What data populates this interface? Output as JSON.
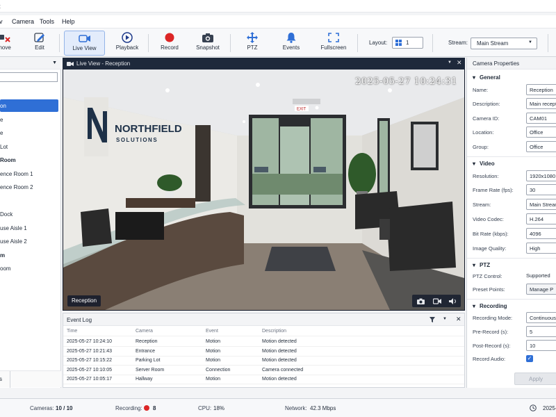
{
  "app": {
    "title_fragment": "t"
  },
  "menu": [
    "v",
    "Camera",
    "Tools",
    "Help"
  ],
  "toolbar": {
    "buttons": [
      {
        "label": "move",
        "icon": "remove-camera-icon"
      },
      {
        "label": "Edit",
        "icon": "edit-icon"
      },
      {
        "label": "Live View",
        "icon": "video-camera-icon"
      },
      {
        "label": "Playback",
        "icon": "play-icon"
      },
      {
        "label": "Record",
        "icon": "record-icon"
      },
      {
        "label": "Snapshot",
        "icon": "camera-icon"
      },
      {
        "label": "PTZ",
        "icon": "ptz-arrows-icon"
      },
      {
        "label": "Events",
        "icon": "bell-icon"
      },
      {
        "label": "Fullscreen",
        "icon": "fullscreen-icon"
      }
    ],
    "layout_label": "Layout:",
    "layout_value": "1",
    "stream_label": "Stream:",
    "stream_value": "Main Stream"
  },
  "tree": {
    "items": [
      {
        "label": "on",
        "selected": true,
        "group": false
      },
      {
        "label": "e",
        "selected": false,
        "group": false
      },
      {
        "label": "e",
        "selected": false,
        "group": false
      },
      {
        "label": "Lot",
        "selected": false,
        "group": false
      },
      {
        "label": "Room",
        "selected": false,
        "group": true
      },
      {
        "label": "ence Room 1",
        "selected": false,
        "group": false
      },
      {
        "label": "ence Room 2",
        "selected": false,
        "group": false
      },
      {
        "label": "",
        "selected": false,
        "group": false
      },
      {
        "label": "Dock",
        "selected": false,
        "group": false
      },
      {
        "label": "use Aisle 1",
        "selected": false,
        "group": false
      },
      {
        "label": "use Aisle 2",
        "selected": false,
        "group": false
      },
      {
        "label": "m",
        "selected": false,
        "group": true
      },
      {
        "label": "oom",
        "selected": false,
        "group": false
      }
    ],
    "footer_tab": "s"
  },
  "liveview": {
    "title": "Live View - Reception",
    "timestamp": "2025-05-27 10:24:31",
    "camera_label": "Reception",
    "sign_line1": "NORTHFIELD",
    "sign_line2": "SOLUTIONS",
    "exit_sign": "EXIT"
  },
  "eventlog": {
    "title": "Event Log",
    "columns": [
      "Time",
      "Camera",
      "Event",
      "Description"
    ],
    "rows": [
      [
        "2025-05-27 10:24:10",
        "Reception",
        "Motion",
        "Motion detected"
      ],
      [
        "2025-05-27 10:21:43",
        "Entrance",
        "Motion",
        "Motion detected"
      ],
      [
        "2025-05-27 10:15:22",
        "Parking Lot",
        "Motion",
        "Motion detected"
      ],
      [
        "2025-05-27 10:10:05",
        "Server Room",
        "Connection",
        "Camera connected"
      ],
      [
        "2025-05-27 10:05:17",
        "Hallway",
        "Motion",
        "Motion detected"
      ]
    ]
  },
  "properties": {
    "title": "Camera Properties",
    "general": {
      "heading": "General",
      "fields": [
        {
          "label": "Name:",
          "value": "Reception"
        },
        {
          "label": "Description:",
          "value": "Main reception"
        },
        {
          "label": "Camera ID:",
          "value": "CAM01"
        },
        {
          "label": "Location:",
          "value": "Office"
        },
        {
          "label": "Group:",
          "value": "Office"
        }
      ]
    },
    "video": {
      "heading": "Video",
      "fields": [
        {
          "label": "Resolution:",
          "value": "1920x1080"
        },
        {
          "label": "Frame Rate (fps):",
          "value": "30"
        },
        {
          "label": "Stream:",
          "value": "Main Stream"
        },
        {
          "label": "Video Codec:",
          "value": "H.264"
        },
        {
          "label": "Bit Rate (kbps):",
          "value": "4096"
        },
        {
          "label": "Image Quality:",
          "value": "High"
        }
      ]
    },
    "ptz": {
      "heading": "PTZ",
      "control_label": "PTZ Control:",
      "control_value": "Supported",
      "preset_label": "Preset Points:",
      "preset_button": "Manage P"
    },
    "recording": {
      "heading": "Recording",
      "fields": [
        {
          "label": "Recording Mode:",
          "value": "Continuous"
        },
        {
          "label": "Pre-Record (s):",
          "value": "5"
        },
        {
          "label": "Post-Record (s):",
          "value": "10"
        }
      ],
      "audio_label": "Record Audio:",
      "audio_checked": true
    },
    "apply_label": "Apply"
  },
  "status": {
    "cameras_label": "Cameras:",
    "cameras_value": "10 / 10",
    "recording_label": "Recording:",
    "recording_value": "8",
    "cpu_label": "CPU:",
    "cpu_value": "18%",
    "network_label": "Network:",
    "network_value": "42.3 Mbps",
    "clock_value": "2025-"
  },
  "colors": {
    "accent": "#2f6fd6",
    "record_red": "#dc2626",
    "header_dark": "#1e293b"
  }
}
